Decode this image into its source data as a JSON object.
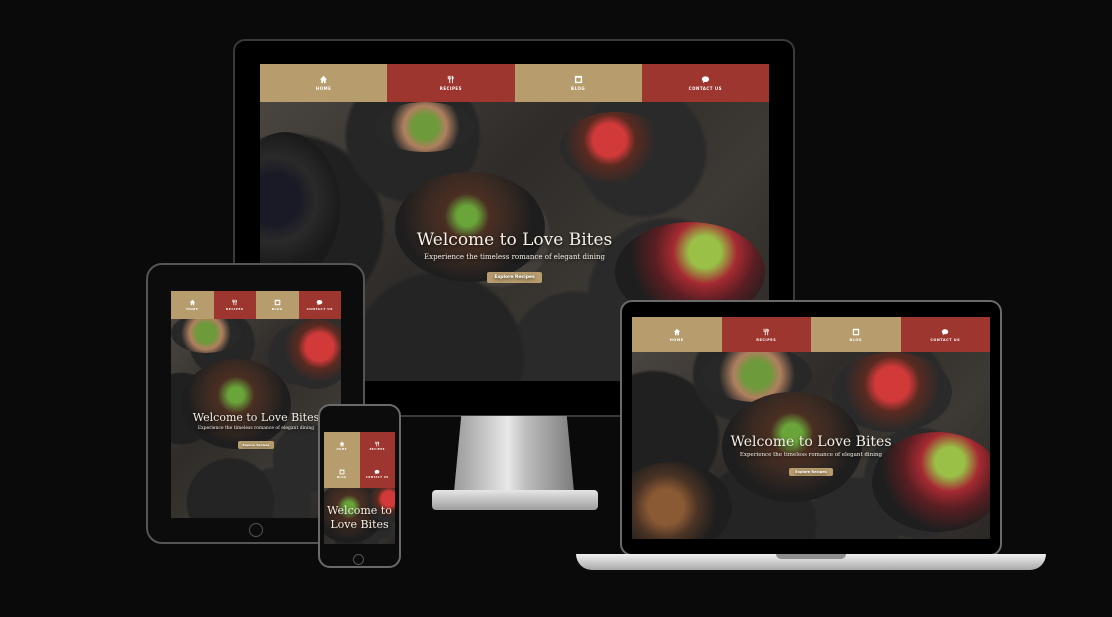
{
  "nav": [
    {
      "label": "HOME",
      "icon": "home-icon",
      "color": "#b79c6d"
    },
    {
      "label": "RECIPES",
      "icon": "utensils-icon",
      "color": "#9e3630"
    },
    {
      "label": "BLOG",
      "icon": "blog-icon",
      "color": "#b79c6d"
    },
    {
      "label": "CONTACT US",
      "icon": "chat-icon",
      "color": "#9e3630"
    }
  ],
  "hero": {
    "title": "Welcome to Love Bites",
    "subtitle": "Experience the timeless romance of elegant dining",
    "button": "Explore Recipes"
  },
  "colors": {
    "gold": "#b79c6d",
    "red": "#9e3630",
    "background": "#0a0a0a"
  }
}
